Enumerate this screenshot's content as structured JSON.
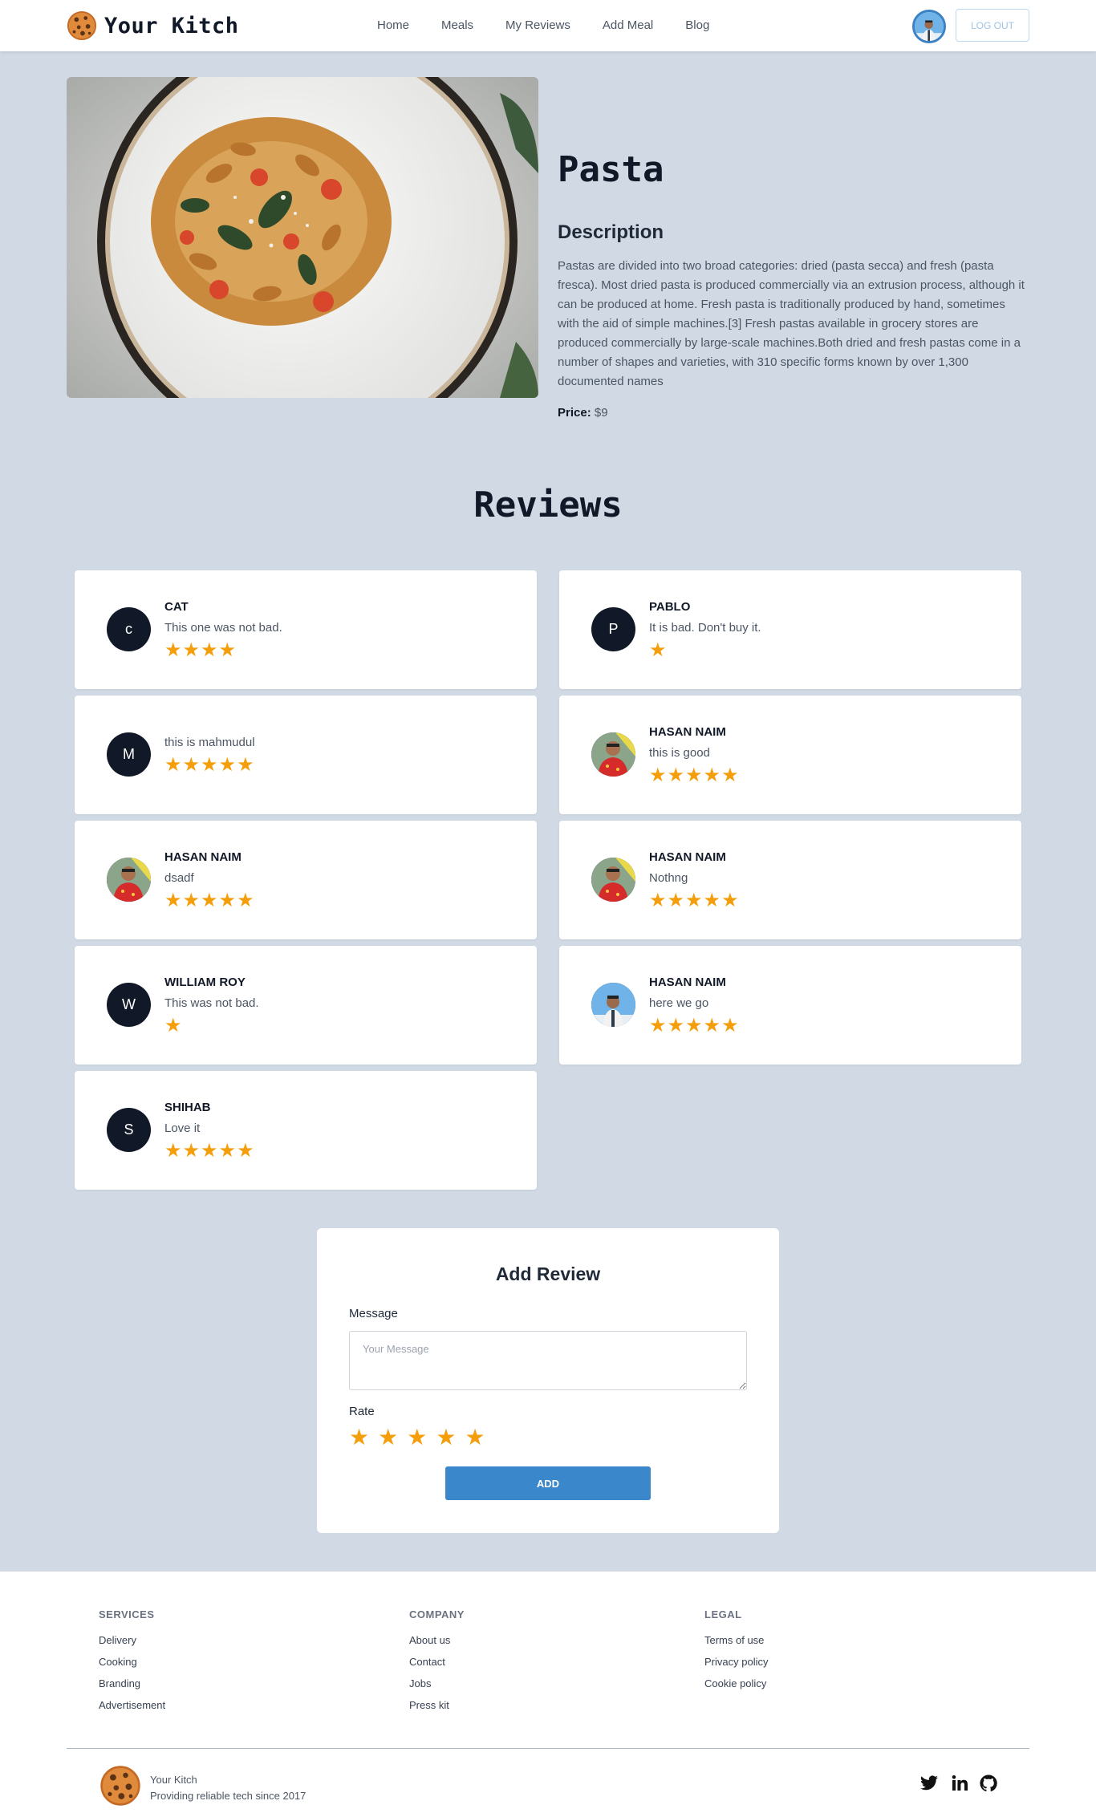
{
  "nav": {
    "brand": "Your Kitch",
    "links": [
      "Home",
      "Meals",
      "My Reviews",
      "Add Meal",
      "Blog"
    ],
    "logout_label": "LOG OUT"
  },
  "meal": {
    "title": "Pasta",
    "description_heading": "Description",
    "description": "Pastas are divided into two broad categories: dried (pasta secca) and fresh (pasta fresca). Most dried pasta is produced commercially via an extrusion process, although it can be produced at home. Fresh pasta is traditionally produced by hand, sometimes with the aid of simple machines.[3] Fresh pastas available in grocery stores are produced commercially by large-scale machines.Both dried and fresh pastas come in a number of shapes and varieties, with 310 specific forms known by over 1,300 documented names",
    "price_label": "Price:",
    "price": "$9"
  },
  "reviews": {
    "title": "Reviews",
    "items": [
      {
        "name": "CAT",
        "text": "This one was not bad.",
        "rating": 4,
        "initial": "c",
        "photo": false
      },
      {
        "name": "PABLO",
        "text": "It is bad. Don't buy it.",
        "rating": 1,
        "initial": "P",
        "photo": false
      },
      {
        "name": "",
        "text": "this is mahmudul",
        "rating": 5,
        "initial": "M",
        "photo": false
      },
      {
        "name": "HASAN NAIM",
        "text": "this is good",
        "rating": 5,
        "initial": "",
        "photo": "red"
      },
      {
        "name": "HASAN NAIM",
        "text": "dsadf",
        "rating": 5,
        "initial": "",
        "photo": "red"
      },
      {
        "name": "HASAN NAIM",
        "text": "Nothng",
        "rating": 5,
        "initial": "",
        "photo": "red"
      },
      {
        "name": "WILLIAM ROY",
        "text": "This was not bad.",
        "rating": 1,
        "initial": "W",
        "photo": false
      },
      {
        "name": "HASAN NAIM",
        "text": "here we go",
        "rating": 5,
        "initial": "",
        "photo": "sky"
      },
      {
        "name": "SHIHAB",
        "text": "Love it",
        "rating": 5,
        "initial": "S",
        "photo": false
      }
    ]
  },
  "add_review": {
    "title": "Add Review",
    "message_label": "Message",
    "message_placeholder": "Your Message",
    "rate_label": "Rate",
    "star_count": 5,
    "add_label": "ADD"
  },
  "footer": {
    "services": {
      "heading": "SERVICES",
      "links": [
        "Delivery",
        "Cooking",
        "Branding",
        "Advertisement"
      ]
    },
    "company": {
      "heading": "COMPANY",
      "links": [
        "About us",
        "Contact",
        "Jobs",
        "Press kit"
      ]
    },
    "legal": {
      "heading": "LEGAL",
      "links": [
        "Terms of use",
        "Privacy policy",
        "Cookie policy"
      ]
    },
    "brand_name": "Your Kitch",
    "tagline": "Providing reliable tech since 2017"
  },
  "colors": {
    "page_bg": "#d1dae4",
    "star": "#f59e0b",
    "accent": "#3b87cc",
    "dark": "#111827"
  },
  "icons": [
    "cookie-logo-icon",
    "user-avatar-icon",
    "star-icon",
    "twitter-icon",
    "linkedin-icon",
    "github-icon"
  ]
}
